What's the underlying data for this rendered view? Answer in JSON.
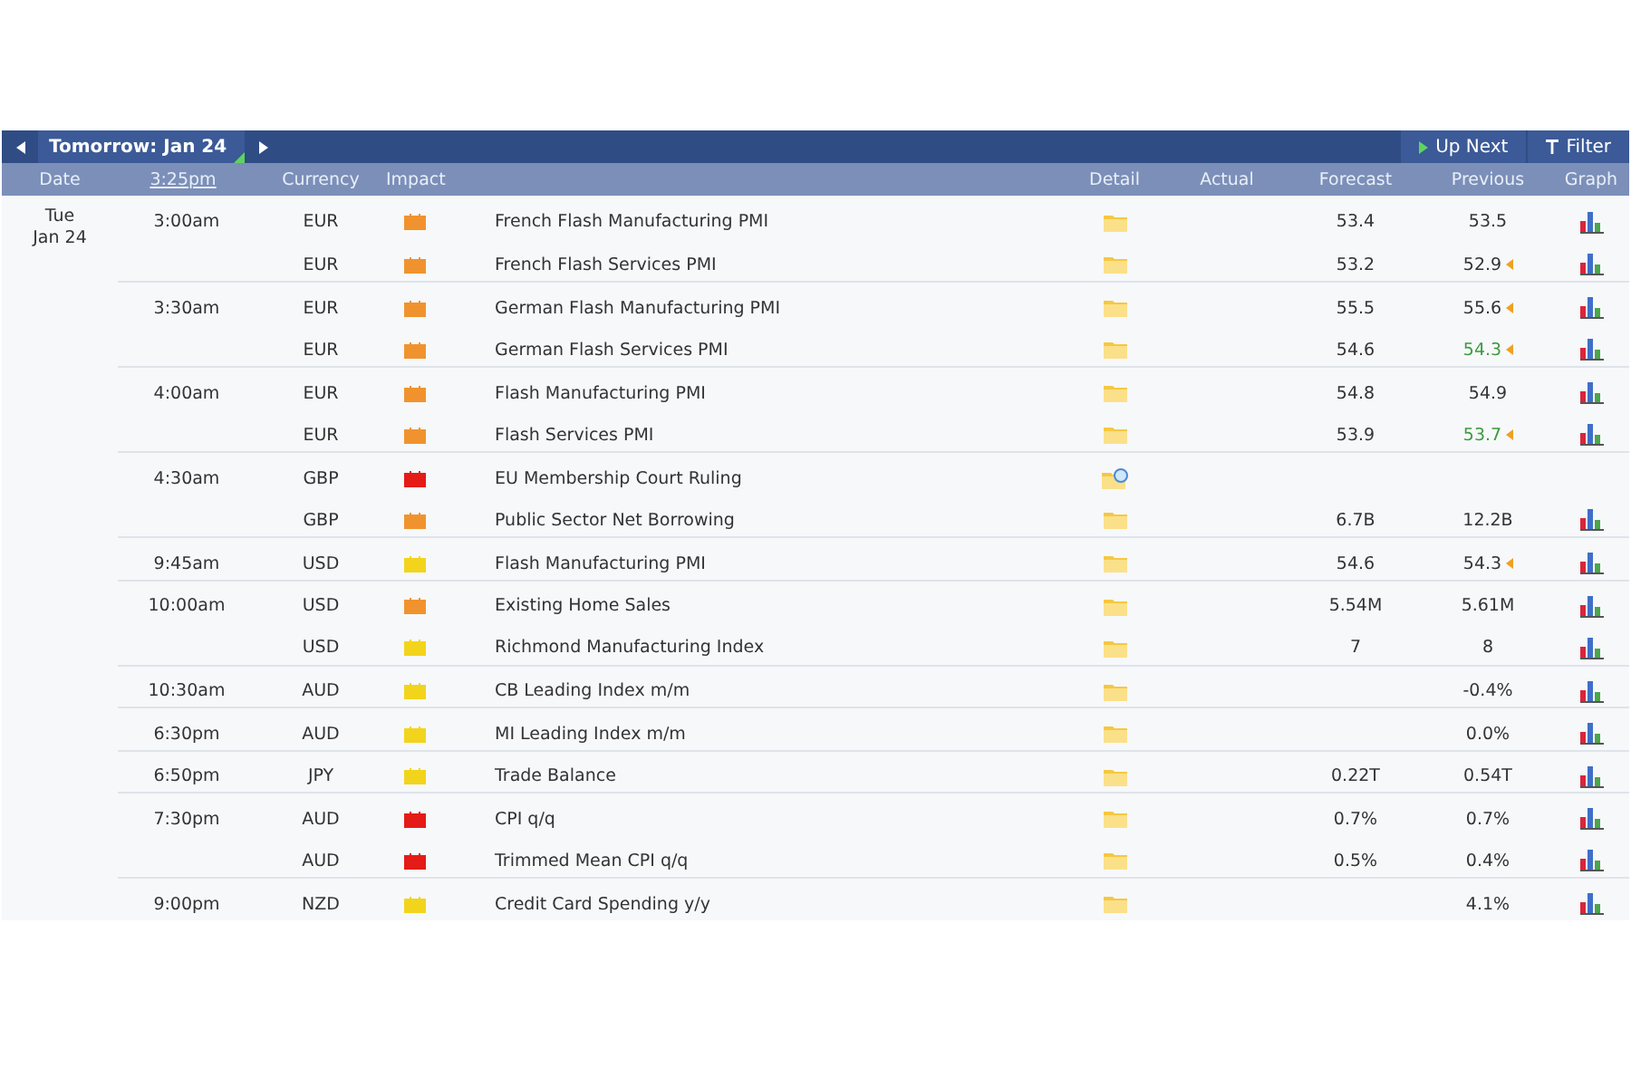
{
  "toolbar": {
    "day_tab": "Tomorrow: Jan 24",
    "up_next": "Up Next",
    "filter": "Filter"
  },
  "columns": {
    "date": "Date",
    "time": "3:25pm",
    "currency": "Currency",
    "impact": "Impact",
    "detail": "Detail",
    "actual": "Actual",
    "forecast": "Forecast",
    "previous": "Previous",
    "graph": "Graph"
  },
  "day": {
    "weekday": "Tue",
    "date": "Jan 24"
  },
  "rows": [
    {
      "time": "3:00am",
      "currency": "EUR",
      "impact": {
        "color": "#f0932e"
      },
      "event": "French Flash Manufacturing PMI",
      "detail": {
        "kind": "folder"
      },
      "forecast": "53.4",
      "previous": "53.5",
      "revised": false,
      "previous_better": false,
      "graph": true
    },
    {
      "currency": "EUR",
      "impact": {
        "color": "#f0932e"
      },
      "event": "French Flash Services PMI",
      "detail": {
        "kind": "folder"
      },
      "forecast": "53.2",
      "previous": "52.9",
      "revised": true,
      "previous_better": false,
      "graph": true
    },
    {
      "time": "3:30am",
      "currency": "EUR",
      "impact": {
        "color": "#f0932e"
      },
      "event": "German Flash Manufacturing PMI",
      "detail": {
        "kind": "folder"
      },
      "forecast": "55.5",
      "previous": "55.6",
      "revised": true,
      "previous_better": false,
      "graph": true
    },
    {
      "currency": "EUR",
      "impact": {
        "color": "#f0932e"
      },
      "event": "German Flash Services PMI",
      "detail": {
        "kind": "folder"
      },
      "forecast": "54.6",
      "previous": "54.3",
      "revised": true,
      "previous_better": true,
      "graph": true
    },
    {
      "time": "4:00am",
      "currency": "EUR",
      "impact": {
        "color": "#f0932e"
      },
      "event": "Flash Manufacturing PMI",
      "detail": {
        "kind": "folder"
      },
      "forecast": "54.8",
      "previous": "54.9",
      "revised": false,
      "previous_better": false,
      "graph": true
    },
    {
      "currency": "EUR",
      "impact": {
        "color": "#f0932e"
      },
      "event": "Flash Services PMI",
      "detail": {
        "kind": "folder"
      },
      "forecast": "53.9",
      "previous": "53.7",
      "revised": true,
      "previous_better": true,
      "graph": true
    },
    {
      "time": "4:30am",
      "currency": "GBP",
      "impact": {
        "color": "#e41b17"
      },
      "event": "EU Membership Court Ruling",
      "detail": {
        "kind": "updated"
      },
      "revised": false,
      "graph": false
    },
    {
      "currency": "GBP",
      "impact": {
        "color": "#f0932e"
      },
      "event": "Public Sector Net Borrowing",
      "detail": {
        "kind": "folder"
      },
      "forecast": "6.7B",
      "previous": "12.2B",
      "revised": false,
      "previous_better": false,
      "graph": true
    },
    {
      "time": "9:45am",
      "currency": "USD",
      "impact": {
        "color": "#f2d41c"
      },
      "event": "Flash Manufacturing PMI",
      "detail": {
        "kind": "folder"
      },
      "forecast": "54.6",
      "previous": "54.3",
      "revised": true,
      "previous_better": false,
      "graph": true
    },
    {
      "time": "10:00am",
      "currency": "USD",
      "impact": {
        "color": "#f0932e"
      },
      "event": "Existing Home Sales",
      "detail": {
        "kind": "folder"
      },
      "forecast": "5.54M",
      "previous": "5.61M",
      "revised": false,
      "previous_better": false,
      "graph": true
    },
    {
      "currency": "USD",
      "impact": {
        "color": "#f2d41c"
      },
      "event": "Richmond Manufacturing Index",
      "detail": {
        "kind": "folder"
      },
      "forecast": "7",
      "previous": "8",
      "revised": false,
      "previous_better": false,
      "graph": true
    },
    {
      "time": "10:30am",
      "currency": "AUD",
      "impact": {
        "color": "#f2d41c"
      },
      "event": "CB Leading Index m/m",
      "detail": {
        "kind": "folder"
      },
      "previous": "-0.4%",
      "revised": false,
      "previous_better": false,
      "graph": true
    },
    {
      "time": "6:30pm",
      "currency": "AUD",
      "impact": {
        "color": "#f2d41c"
      },
      "event": "MI Leading Index m/m",
      "detail": {
        "kind": "folder"
      },
      "previous": "0.0%",
      "revised": false,
      "previous_better": false,
      "graph": true
    },
    {
      "time": "6:50pm",
      "currency": "JPY",
      "impact": {
        "color": "#f2d41c"
      },
      "event": "Trade Balance",
      "detail": {
        "kind": "folder"
      },
      "forecast": "0.22T",
      "previous": "0.54T",
      "revised": false,
      "previous_better": false,
      "graph": true
    },
    {
      "time": "7:30pm",
      "currency": "AUD",
      "impact": {
        "color": "#e41b17"
      },
      "event": "CPI q/q",
      "detail": {
        "kind": "folder"
      },
      "forecast": "0.7%",
      "previous": "0.7%",
      "revised": false,
      "previous_better": false,
      "graph": true
    },
    {
      "currency": "AUD",
      "impact": {
        "color": "#e41b17"
      },
      "event": "Trimmed Mean CPI q/q",
      "detail": {
        "kind": "folder"
      },
      "forecast": "0.5%",
      "previous": "0.4%",
      "revised": false,
      "previous_better": false,
      "graph": true
    },
    {
      "time": "9:00pm",
      "currency": "NZD",
      "impact": {
        "color": "#f2d41c"
      },
      "event": "Credit Card Spending y/y",
      "detail": {
        "kind": "folder"
      },
      "previous": "4.1%",
      "revised": false,
      "previous_better": false,
      "graph": true
    }
  ]
}
